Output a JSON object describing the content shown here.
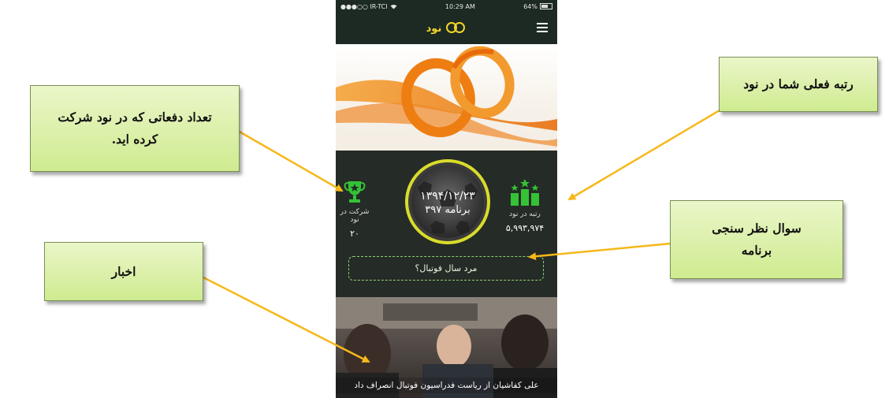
{
  "status_bar": {
    "carrier": "●●●○○ IR-TCI",
    "time": "10:29 AM",
    "battery": "64%"
  },
  "navbar": {
    "logo_text": "نود"
  },
  "stats": {
    "program_date": "۱۳۹۴/۱۲/۲۳",
    "program_number": "برنامه ۳۹۷",
    "participation_label": "شرکت در نود",
    "participation_value": "۲۰",
    "rank_label": "رتبه در نود",
    "rank_value": "۵,۹۹۳,۹۷۴"
  },
  "poll": {
    "question": "مرد سال فوتبال؟"
  },
  "news": {
    "headline": "علی کفاشیان از ریاست فدراسیون فوتبال انصراف داد"
  },
  "callouts": {
    "participation": "تعداد دفعاتی که در نود شرکت کرده اید.",
    "rank": "رتبه فعلی شما در نود",
    "poll": "سوال نظر سنجی برنامه",
    "news": "اخبار"
  },
  "colors": {
    "callout_fill": "#d6ee9c",
    "arrow": "#f6b81a",
    "accent_green": "#3cc43a",
    "ring_yellow": "#d9dc2a"
  }
}
